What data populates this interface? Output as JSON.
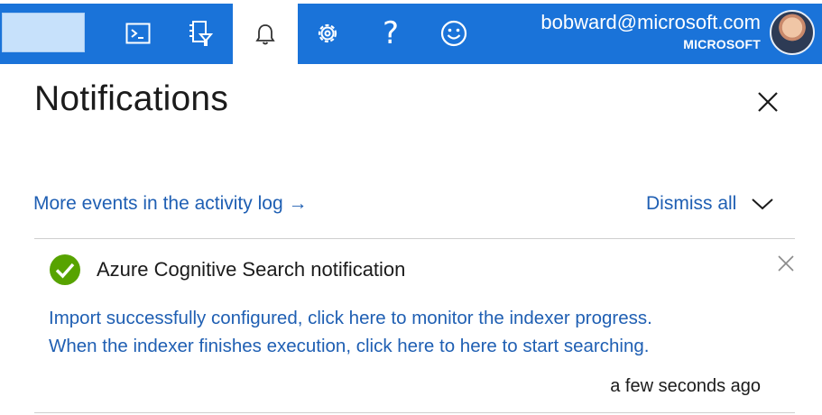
{
  "topbar": {
    "bg_color": "#1a73d9",
    "icons": [
      "cloud-shell-icon",
      "directory-filter-icon",
      "bell-icon",
      "gear-icon",
      "help-icon",
      "feedback-icon"
    ],
    "help_glyph": "?",
    "account": {
      "email": "bobward@microsoft.com",
      "org": "MICROSOFT"
    }
  },
  "panel": {
    "title": "Notifications",
    "activity_link": "More events in the activity log →",
    "dismiss_all": "Dismiss all"
  },
  "notification": {
    "status": "success",
    "status_color": "#57a300",
    "title": "Azure Cognitive Search notification",
    "message_line1": "Import successfully configured, click here to monitor the indexer progress.",
    "message_line2": "When the indexer finishes execution, click here to here to start searching.",
    "time": "a few seconds ago"
  }
}
